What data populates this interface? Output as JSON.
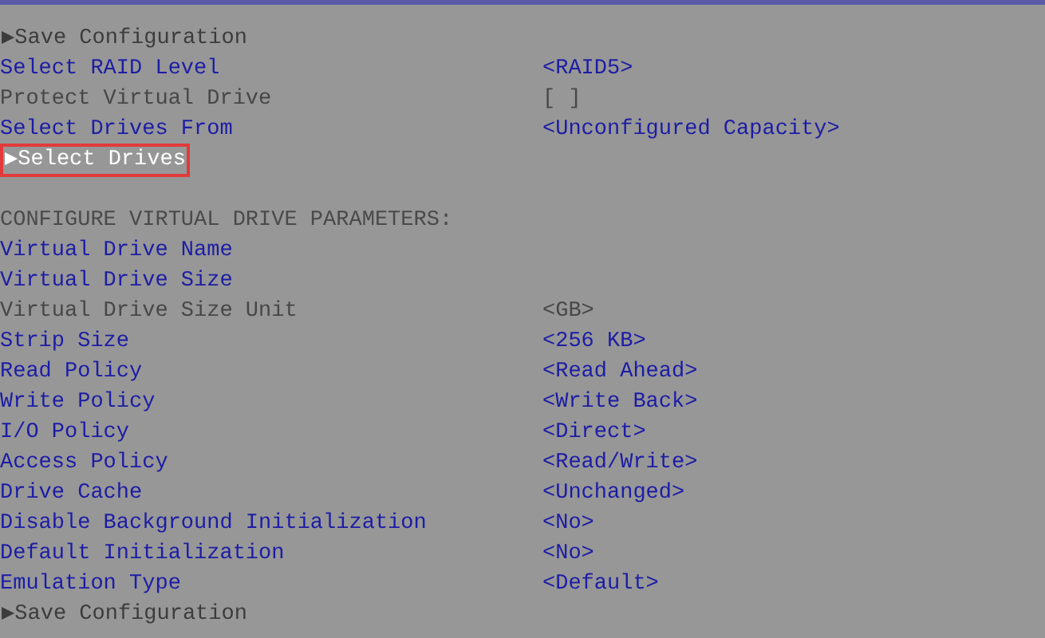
{
  "rows": [
    {
      "kind": "submenu",
      "marker": "▶",
      "label": "Save Configuration",
      "selected": false
    },
    {
      "kind": "option",
      "label": "Select RAID Level",
      "value": "<RAID5>",
      "disabled": false,
      "selected": false
    },
    {
      "kind": "option",
      "label": "Protect Virtual Drive",
      "value": "[ ]",
      "disabled": true,
      "selected": false
    },
    {
      "kind": "option",
      "label": "Select Drives From",
      "value": "<Unconfigured Capacity>",
      "disabled": false,
      "selected": false
    },
    {
      "kind": "submenu",
      "marker": "▶",
      "label": "Select Drives",
      "selected": true
    },
    {
      "kind": "heading",
      "label": "CONFIGURE VIRTUAL DRIVE PARAMETERS:"
    },
    {
      "kind": "option",
      "label": "Virtual Drive Name",
      "disabled": false,
      "selected": false
    },
    {
      "kind": "option",
      "label": "Virtual Drive Size",
      "disabled": false,
      "selected": false
    },
    {
      "kind": "option",
      "label": "Virtual Drive Size Unit",
      "value": "<GB>",
      "disabled": true,
      "selected": false
    },
    {
      "kind": "option",
      "label": "Strip Size",
      "value": "<256 KB>",
      "disabled": false,
      "selected": false
    },
    {
      "kind": "option",
      "label": "Read Policy",
      "value": "<Read Ahead>",
      "disabled": false,
      "selected": false
    },
    {
      "kind": "option",
      "label": "Write Policy",
      "value": "<Write Back>",
      "disabled": false,
      "selected": false
    },
    {
      "kind": "option",
      "label": "I/O Policy",
      "value": "<Direct>",
      "disabled": false,
      "selected": false
    },
    {
      "kind": "option",
      "label": "Access Policy",
      "value": "<Read/Write>",
      "disabled": false,
      "selected": false
    },
    {
      "kind": "option",
      "label": "Drive Cache",
      "value": "<Unchanged>",
      "disabled": false,
      "selected": false
    },
    {
      "kind": "option",
      "label": "Disable Background Initialization",
      "value": "<No>",
      "disabled": false,
      "selected": false
    },
    {
      "kind": "option",
      "label": "Default Initialization",
      "value": "<No>",
      "disabled": false,
      "selected": false
    },
    {
      "kind": "option",
      "label": "Emulation Type",
      "value": "<Default>",
      "disabled": false,
      "selected": false
    },
    {
      "kind": "submenu",
      "marker": "▶",
      "label": "Save Configuration",
      "selected": false
    }
  ]
}
